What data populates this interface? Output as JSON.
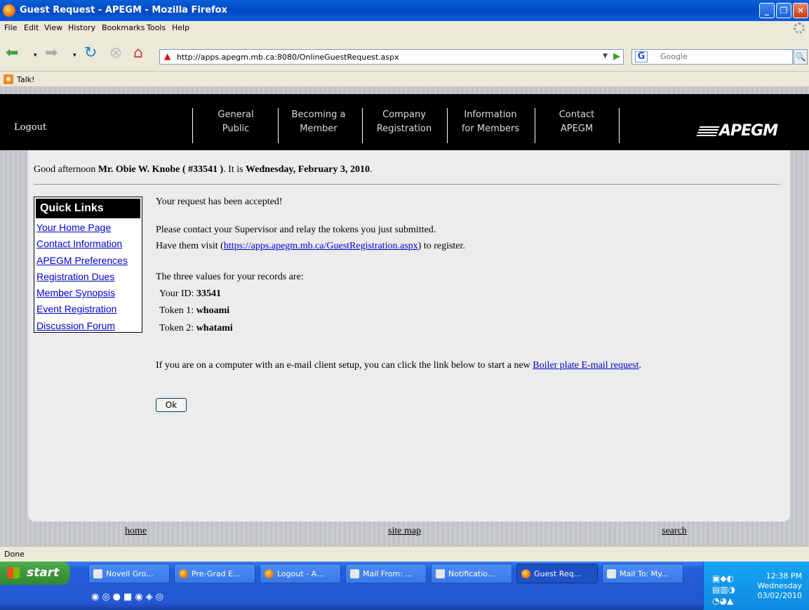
{
  "window": {
    "title": "Guest Request - APEGM - Mozilla Firefox",
    "min_label": "_",
    "max_label": "❐",
    "close_label": "✕"
  },
  "menu": [
    "File",
    "Edit",
    "View",
    "History",
    "Bookmarks",
    "Tools",
    "Help"
  ],
  "toolbar": {
    "url": "http://apps.apegm.mb.ca:8080/OnlineGuestRequest.aspx",
    "search_placeholder": "Google"
  },
  "bookmarks": {
    "talk": "Talk!"
  },
  "site": {
    "logout": "Logout",
    "nav": [
      "General\nPublic",
      "Becoming a\nMember",
      "Company\nRegistration",
      "Information\nfor Members",
      "Contact\nAPEGM"
    ],
    "logo": "APEGM"
  },
  "greeting": {
    "prefix": "Good afternoon ",
    "name": "Mr. Obie W. Knobe ( #33541 )",
    "middle": ". It is ",
    "date": "Wednesday, February 3, 2010",
    "suffix": "."
  },
  "quick_links": {
    "title": "Quick Links",
    "items": [
      "Your Home Page",
      "Contact Information",
      "APEGM Preferences",
      "Registration Dues",
      "Member Synopsis",
      "Event Registration",
      "Discussion Forum"
    ]
  },
  "message": {
    "accepted": "Your request has been accepted!",
    "contact": "Please contact your Supervisor and relay the tokens you just submitted.",
    "visit_prefix": "Have them visit (",
    "visit_link": "https://apps.apegm.mb.ca/GuestRegistration.aspx",
    "visit_suffix": ") to register.",
    "values_intro": "The three values for your records are:",
    "id_label": "Your ID: ",
    "id_value": "33541",
    "token1_label": "Token 1: ",
    "token1_value": "whoami",
    "token2_label": "Token 2: ",
    "token2_value": "whatami",
    "email_prefix": "If you are on a computer with an e-mail client setup, you can click the link below to start a new ",
    "email_link": "Boiler plate E-mail request",
    "email_suffix": ".",
    "ok": "Ok"
  },
  "footer": {
    "home": "home",
    "sitemap": "site map",
    "search": "search"
  },
  "status": "Done",
  "taskbar": {
    "start": "start",
    "buttons": [
      {
        "label": "Novell Gro...",
        "icon": "novell-icon"
      },
      {
        "label": "Pre-Grad E...",
        "icon": "firefox-icon"
      },
      {
        "label": "Logout - A...",
        "icon": "firefox-icon"
      },
      {
        "label": "Mail From: ...",
        "icon": "mail-icon"
      },
      {
        "label": "Notificatio...",
        "icon": "word-icon"
      },
      {
        "label": "Guest Req...",
        "icon": "firefox-icon"
      },
      {
        "label": "Mail To: My...",
        "icon": "mail-icon"
      }
    ],
    "time": "12:38 PM",
    "day": "Wednesday",
    "date": "03/02/2010"
  }
}
